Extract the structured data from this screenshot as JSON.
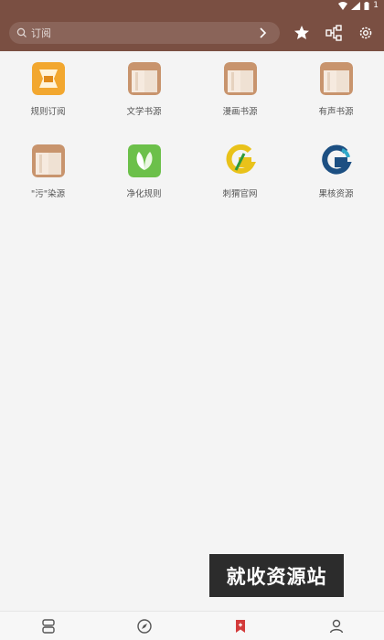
{
  "status": {
    "battery_text": "1"
  },
  "search": {
    "placeholder": "订阅"
  },
  "tiles": [
    {
      "label": "规则订阅",
      "icon": "rule-subscribe-icon"
    },
    {
      "label": "文学书源",
      "icon": "book-source-icon"
    },
    {
      "label": "漫画书源",
      "icon": "book-source-icon"
    },
    {
      "label": "有声书源",
      "icon": "book-source-icon"
    },
    {
      "label": "\"污\"染源",
      "icon": "book-source-icon"
    },
    {
      "label": "净化规则",
      "icon": "leaf-icon"
    },
    {
      "label": "刺猬官网",
      "icon": "g-logo-yellow-icon"
    },
    {
      "label": "果核资源",
      "icon": "g-logo-blue-icon"
    }
  ],
  "watermark": {
    "text": "就收资源站"
  },
  "colors": {
    "topbar": "#7a4f42",
    "nav_active": "#d33b3b",
    "book": "#c8946d"
  }
}
